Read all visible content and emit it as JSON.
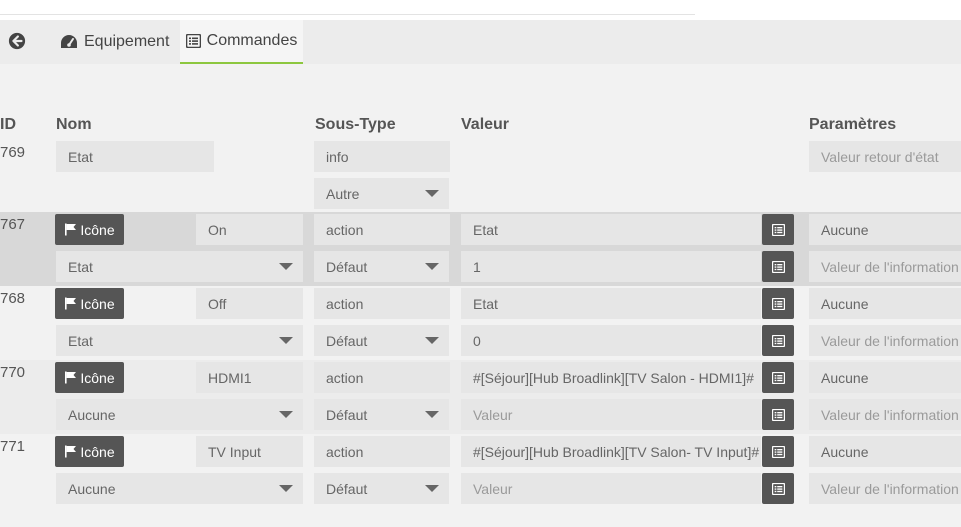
{
  "tabs": {
    "equipement_label": "Equipement",
    "commandes_label": "Commandes"
  },
  "table": {
    "headers": {
      "id": "ID",
      "nom": "Nom",
      "sous_type": "Sous-Type",
      "valeur": "Valeur",
      "parametres": "Paramètres"
    },
    "info_row": {
      "id": "769",
      "name": "Etat",
      "type": "info",
      "subtype": "Autre",
      "param_placeholder": "Valeur retour d'état"
    },
    "action_rows": [
      {
        "id": "767",
        "icon_label": "Icône",
        "name": "On",
        "type": "action",
        "value": "Etat",
        "param": "Aucune",
        "link": "Etat",
        "subtype": "Défaut",
        "value2": "1",
        "value2_placeholder": "Valeur",
        "param2_placeholder": "Valeur de l'information"
      },
      {
        "id": "768",
        "icon_label": "Icône",
        "name": "Off",
        "type": "action",
        "value": "Etat",
        "param": "Aucune",
        "link": "Etat",
        "subtype": "Défaut",
        "value2": "0",
        "value2_placeholder": "Valeur",
        "param2_placeholder": "Valeur de l'information"
      },
      {
        "id": "770",
        "icon_label": "Icône",
        "name": "HDMI1",
        "type": "action",
        "value": "#[Séjour][Hub Broadlink][TV Salon - HDMI1]#",
        "param": "Aucune",
        "link": "Aucune",
        "subtype": "Défaut",
        "value2": "",
        "value2_placeholder": "Valeur",
        "param2_placeholder": "Valeur de l'information"
      },
      {
        "id": "771",
        "icon_label": "Icône",
        "name": "TV Input",
        "type": "action",
        "value": "#[Séjour][Hub Broadlink][TV Salon- TV Input]#",
        "param": "Aucune",
        "link": "Aucune",
        "subtype": "Défaut",
        "value2": "",
        "value2_placeholder": "Valeur",
        "param2_placeholder": "Valeur de l'information"
      }
    ]
  }
}
